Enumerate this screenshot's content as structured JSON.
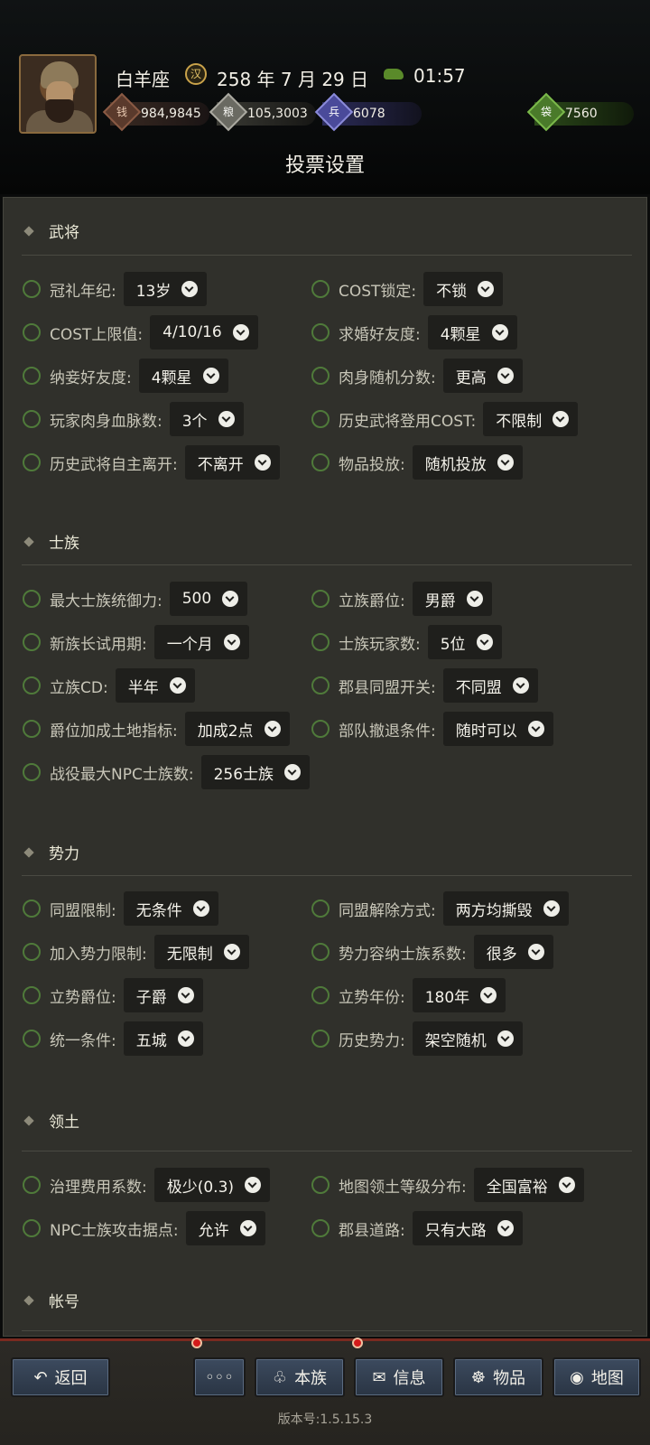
{
  "header": {
    "zodiac": "白羊座",
    "date": "258 年 7 月 29 日",
    "time": "01:57",
    "date_icon_glyph": "汉",
    "resources": [
      {
        "icon": "coin-icon",
        "value": "984,9845",
        "glyph": "钱"
      },
      {
        "icon": "grain-icon",
        "value": "105,3003",
        "glyph": "粮"
      },
      {
        "icon": "soldier-icon",
        "value": "6078",
        "glyph": "兵"
      },
      {
        "icon": "bag-icon",
        "value": "7560",
        "glyph": "袋"
      }
    ],
    "title": "投票设置"
  },
  "sections": [
    {
      "title": "武将",
      "options": [
        {
          "label": "冠礼年纪:",
          "value": "13岁"
        },
        {
          "label": "COST锁定:",
          "value": "不锁"
        },
        {
          "label": "COST上限值:",
          "value": "4/10/16"
        },
        {
          "label": "求婚好友度:",
          "value": "4颗星"
        },
        {
          "label": "纳妾好友度:",
          "value": "4颗星"
        },
        {
          "label": "肉身随机分数:",
          "value": "更高"
        },
        {
          "label": "玩家肉身血脉数:",
          "value": "3个"
        },
        {
          "label": "历史武将登用COST:",
          "value": "不限制"
        },
        {
          "label": "历史武将自主离开:",
          "value": "不离开"
        },
        {
          "label": "物品投放:",
          "value": "随机投放"
        }
      ]
    },
    {
      "title": "士族",
      "options": [
        {
          "label": "最大士族统御力:",
          "value": "500"
        },
        {
          "label": "立族爵位:",
          "value": "男爵"
        },
        {
          "label": "新族长试用期:",
          "value": "一个月"
        },
        {
          "label": "士族玩家数:",
          "value": "5位"
        },
        {
          "label": "立族CD:",
          "value": "半年"
        },
        {
          "label": "郡县同盟开关:",
          "value": "不同盟"
        },
        {
          "label": "爵位加成土地指标:",
          "value": "加成2点"
        },
        {
          "label": "部队撤退条件:",
          "value": "随时可以"
        },
        {
          "label": "战役最大NPC士族数:",
          "value": "256士族"
        }
      ]
    },
    {
      "title": "势力",
      "options": [
        {
          "label": "同盟限制:",
          "value": "无条件"
        },
        {
          "label": "同盟解除方式:",
          "value": "两方均撕毁"
        },
        {
          "label": "加入势力限制:",
          "value": "无限制"
        },
        {
          "label": "势力容纳士族系数:",
          "value": "很多"
        },
        {
          "label": "立势爵位:",
          "value": "子爵"
        },
        {
          "label": "立势年份:",
          "value": "180年"
        },
        {
          "label": "统一条件:",
          "value": "五城"
        },
        {
          "label": "历史势力:",
          "value": "架空随机"
        }
      ]
    },
    {
      "title": "领土",
      "options": [
        {
          "label": "治理费用系数:",
          "value": "极少(0.3)"
        },
        {
          "label": "地图领土等级分布:",
          "value": "全国富裕"
        },
        {
          "label": "NPC士族攻击据点:",
          "value": "允许"
        },
        {
          "label": "郡县道路:",
          "value": "只有大路"
        }
      ]
    },
    {
      "title": "帐号",
      "options": []
    }
  ],
  "bottombar": {
    "back": "返回",
    "more": "◦◦◦",
    "clan": "本族",
    "info": "信息",
    "items": "物品",
    "map": "地图",
    "version": "版本号:1.5.15.3"
  }
}
